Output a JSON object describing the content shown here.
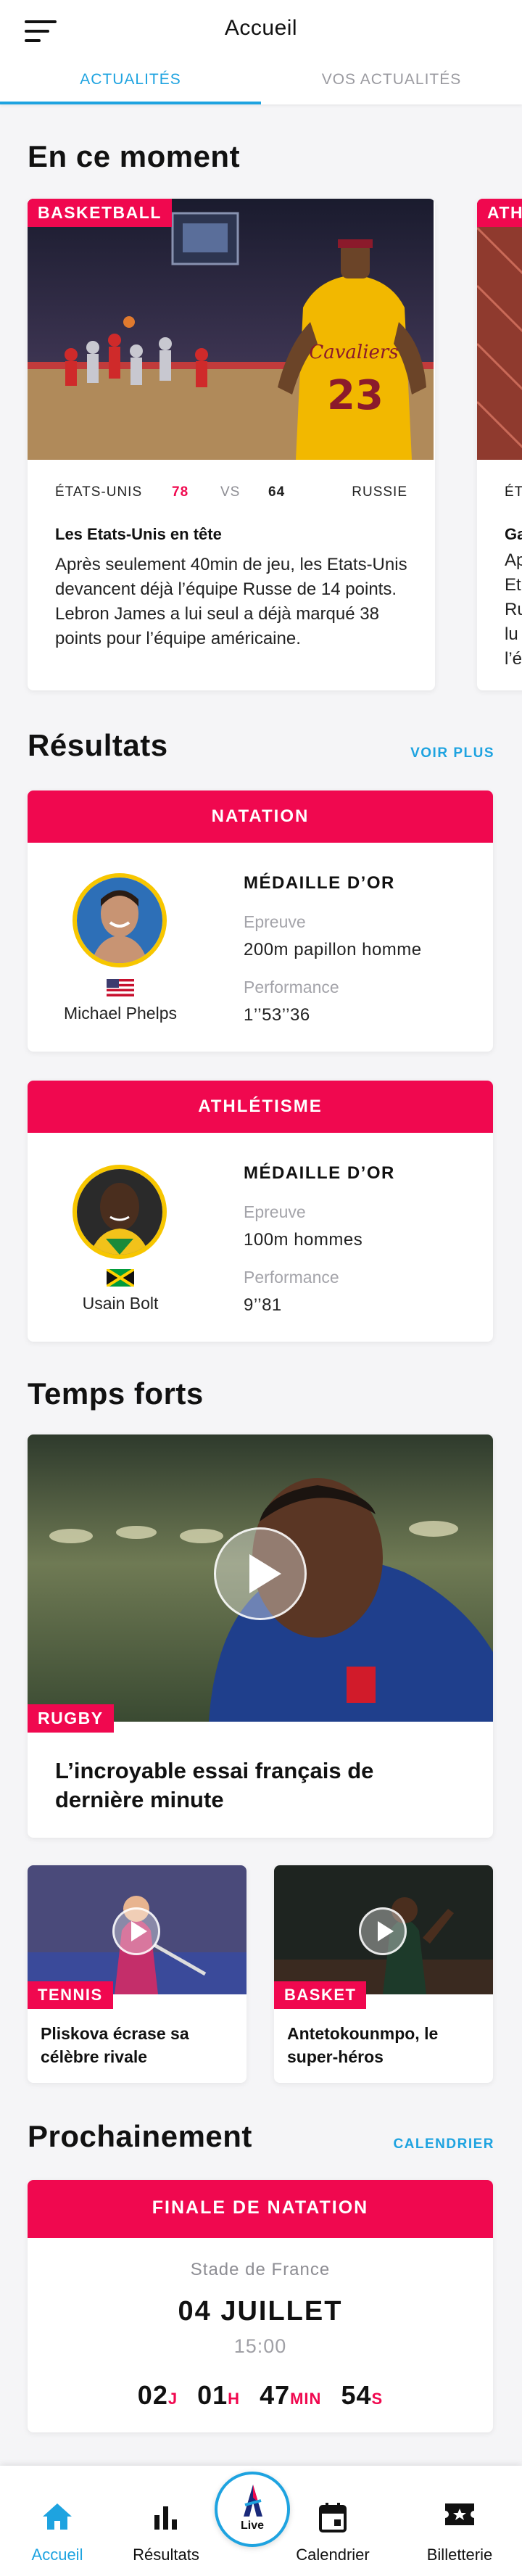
{
  "header": {
    "title": "Accueil",
    "tabs": [
      {
        "label": "ACTUALITÉS",
        "active": true
      },
      {
        "label": "VOS ACTUALITÉS",
        "active": false
      }
    ]
  },
  "now": {
    "title": "En ce moment",
    "cards": [
      {
        "badge": "BASKETBALL",
        "team1": "ÉTATS-UNIS",
        "score1": "78",
        "vs": "VS",
        "score2": "64",
        "team2": "RUSSIE",
        "headline": "Les Etats-Unis en tête",
        "text": "Après seulement 40min de jeu, les Etats-Unis devancent déjà l’équipe Russe de 14 points. Lebron James a lui seul a déjà marqué 38 points pour l’équipe américaine."
      },
      {
        "badge": "ATH",
        "team1": "ÉT",
        "headline": "Ga",
        "lines": [
          "Ap",
          "Et",
          "Ru",
          "lu",
          "l’é"
        ]
      }
    ]
  },
  "results": {
    "title": "Résultats",
    "more": "VOIR PLUS",
    "cards": [
      {
        "sport": "NATATION",
        "athlete": "Michael Phelps",
        "medal": "MÉDAILLE D’OR",
        "event_label": "Epreuve",
        "event": "200m papillon homme",
        "perf_label": "Performance",
        "perf": "1’’53’’36"
      },
      {
        "sport": "ATHLÉTISME",
        "athlete": "Usain Bolt",
        "medal": "MÉDAILLE D’OR",
        "event_label": "Epreuve",
        "event": "100m hommes",
        "perf_label": "Performance",
        "perf": "9’’81"
      }
    ]
  },
  "highlights": {
    "title": "Temps forts",
    "main": {
      "badge": "RUGBY",
      "title": "L’incroyable essai français de dernière minute"
    },
    "small": [
      {
        "badge": "TENNIS",
        "title": "Pliskova écrase sa célèbre rivale"
      },
      {
        "badge": "BASKET",
        "title": "Antetokounmpo, le super-héros"
      }
    ]
  },
  "upcoming": {
    "title": "Prochainement",
    "link": "CALENDRIER",
    "event": "FINALE DE NATATION",
    "venue": "Stade de France",
    "date": "04 JUILLET",
    "time": "15:00",
    "countdown": [
      {
        "value": "02",
        "unit": "J"
      },
      {
        "value": "01",
        "unit": "H"
      },
      {
        "value": "47",
        "unit": "MIN"
      },
      {
        "value": "54",
        "unit": "S"
      }
    ]
  },
  "nav": {
    "items": [
      {
        "label": "Accueil",
        "icon": "home-icon",
        "active": true
      },
      {
        "label": "Résultats",
        "icon": "bar-chart-icon"
      },
      {
        "label": "Live",
        "icon": "live-icon"
      },
      {
        "label": "Calendrier",
        "icon": "calendar-icon"
      },
      {
        "label": "Billetterie",
        "icon": "ticket-icon"
      }
    ]
  },
  "colors": {
    "accent": "#f0084f",
    "link": "#1ea3e0",
    "medal_gold": "#f7c600"
  }
}
